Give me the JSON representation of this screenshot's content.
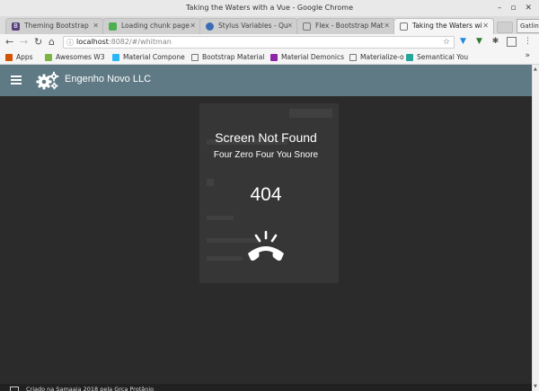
{
  "window": {
    "title": "Taking the Waters with a Vue - Google Chrome"
  },
  "tabs": [
    {
      "label": "Theming Bootstrap",
      "favicon_color": "#563d7c",
      "favicon_text": "B"
    },
    {
      "label": "Loading chunk page",
      "favicon_color": "#4caf50",
      "favicon_text": ""
    },
    {
      "label": "Stylus Variables - Qu",
      "favicon_color": "#3b6db3",
      "favicon_text": ""
    },
    {
      "label": "Flex - Bootstrap Mat",
      "favicon_color": "#777777",
      "favicon_text": ""
    },
    {
      "label": "Taking the Waters wi",
      "favicon_color": "#777777",
      "favicon_text": ""
    }
  ],
  "profile": {
    "label": "Gatlin"
  },
  "address": {
    "host": "localhost",
    "path": ":8082/#/whitman"
  },
  "bookmarks": [
    {
      "label": "Apps",
      "color": "#d35400"
    },
    {
      "label": "Awesomes W3",
      "color": "#7cb342"
    },
    {
      "label": "Material Compone",
      "color": "#29b6f6"
    },
    {
      "label": "Bootstrap Material",
      "color": "#9e9e9e"
    },
    {
      "label": "Material Demonics",
      "color": "#8e24aa"
    },
    {
      "label": "Materialize-o",
      "color": "#9e9e9e"
    },
    {
      "label": "Semantical You",
      "color": "#26a69a"
    }
  ],
  "app": {
    "brand": "Engenho Novo LLC"
  },
  "message": {
    "title": "Screen Not Found",
    "subtitle": "Four Zero Four You Snore",
    "code": "404"
  },
  "footer": {
    "text": "Criado na Samaaia 2018 pela Grça Protânio"
  },
  "colors": {
    "appbar": "#5f7a85",
    "background": "#2b2b2b"
  }
}
